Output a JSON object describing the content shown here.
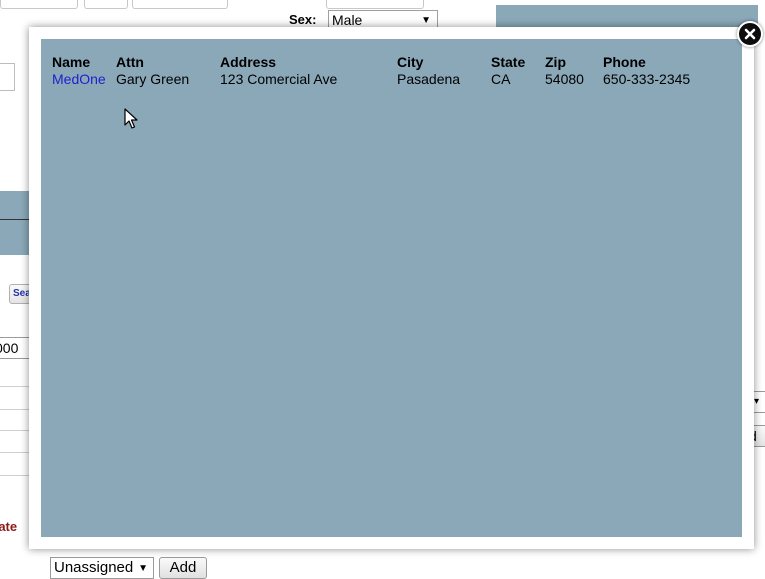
{
  "background": {
    "sex_label": "Sex:",
    "sex_value": "Male",
    "search_button_label": "Sea",
    "left_field_value": "000",
    "state_label": "tate",
    "right_select_arrow": "▾",
    "right_button_label": "d",
    "assignee_select_value": "Unassigned",
    "add_button_label": "Add"
  },
  "modal": {
    "columns": {
      "name": "Name",
      "attn": "Attn",
      "address": "Address",
      "city": "City",
      "state": "State",
      "zip": "Zip",
      "phone": "Phone"
    },
    "rows": [
      {
        "name": "MedOne",
        "attn": "Gary Green",
        "address": "123 Comercial Ave",
        "city": "Pasadena",
        "state": "CA",
        "zip": "54080",
        "phone": "650-333-2345"
      }
    ]
  },
  "icons": {
    "close": "close-icon",
    "dropdown": "chevron-down-icon",
    "pointer": "mouse-pointer-icon"
  },
  "colors": {
    "panel": "#8aa8b8",
    "link": "#1f1fcc",
    "state_label": "#8b1a1a"
  }
}
